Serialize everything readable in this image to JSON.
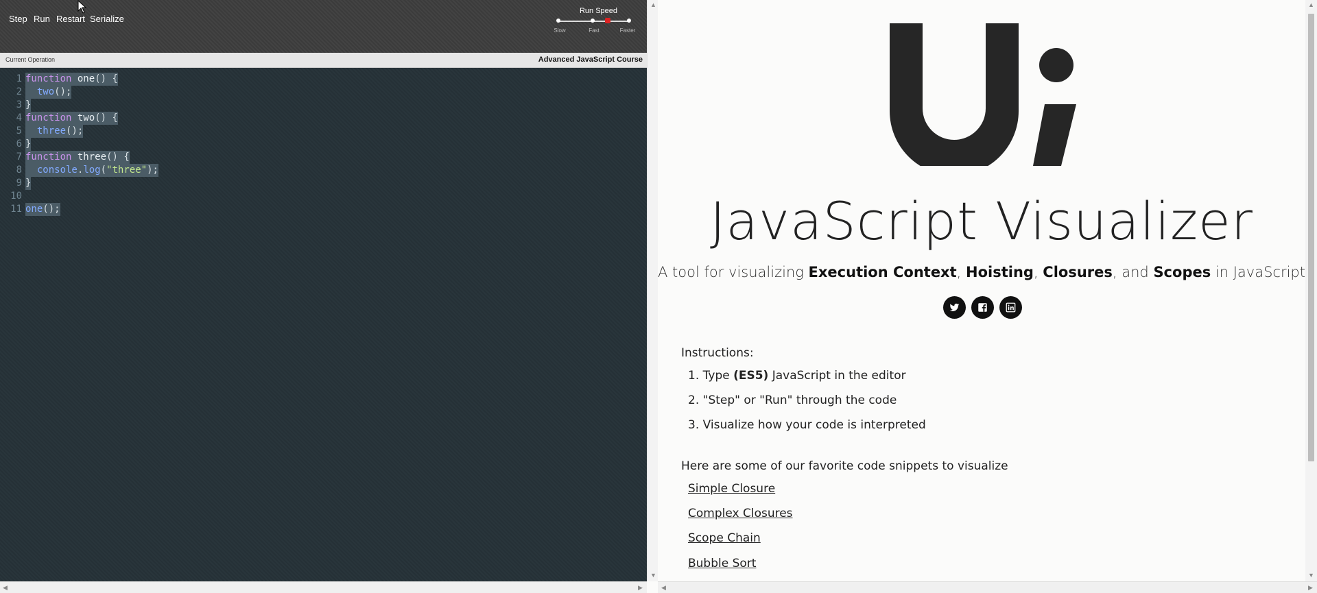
{
  "toolbar": {
    "step": "Step",
    "run": "Run",
    "restart": "Restart",
    "serialize": "Serialize",
    "run_speed_label": "Run Speed",
    "speed_ticks": [
      "Slow",
      "Fast",
      "Faster"
    ],
    "speed_value": "Fast"
  },
  "op_bar": {
    "current_operation_label": "Current Operation",
    "course_label": "Advanced JavaScript Course"
  },
  "editor": {
    "line_numbers": [
      "1",
      "2",
      "3",
      "4",
      "5",
      "6",
      "7",
      "8",
      "9",
      "10",
      "11"
    ],
    "code_lines": [
      "function one() {",
      "  two();",
      "}",
      "function two() {",
      "  three();",
      "}",
      "function three() {",
      "  console.log(\"three\");",
      "}",
      "",
      "one();"
    ]
  },
  "page": {
    "logo_text": "Ui",
    "title": "JavaScript Visualizer",
    "subtitle": {
      "prefix": "A tool for visualizing ",
      "term1": "Execution Context",
      "sep1": ", ",
      "term2": "Hoisting",
      "sep2": ", ",
      "term3": "Closures",
      "sep3": ", and ",
      "term4": "Scopes",
      "suffix": " in JavaScript"
    },
    "social_icons": [
      "twitter-icon",
      "facebook-icon",
      "linkedin-icon"
    ],
    "instructions_title": "Instructions:",
    "instructions": [
      {
        "num": "1.",
        "pre": "Type ",
        "bold": "(ES5)",
        "post": " JavaScript in the editor"
      },
      {
        "num": "2.",
        "pre": "\"Step\" or \"Run\" through the code",
        "bold": "",
        "post": ""
      },
      {
        "num": "3.",
        "pre": "Visualize how your code is interpreted",
        "bold": "",
        "post": ""
      }
    ],
    "snippets_title": "Here are some of our favorite code snippets to visualize",
    "snippets": [
      "Simple Closure",
      "Complex Closures",
      "Scope Chain",
      "Bubble Sort"
    ]
  },
  "colors": {
    "editor_bg": "#263238",
    "toolbar_bg": "#3d3d3d",
    "keyword": "#c792ea",
    "call": "#82aaff",
    "string": "#c3e88d",
    "selection": "#4b5c66",
    "speed_thumb": "#dd2222"
  }
}
